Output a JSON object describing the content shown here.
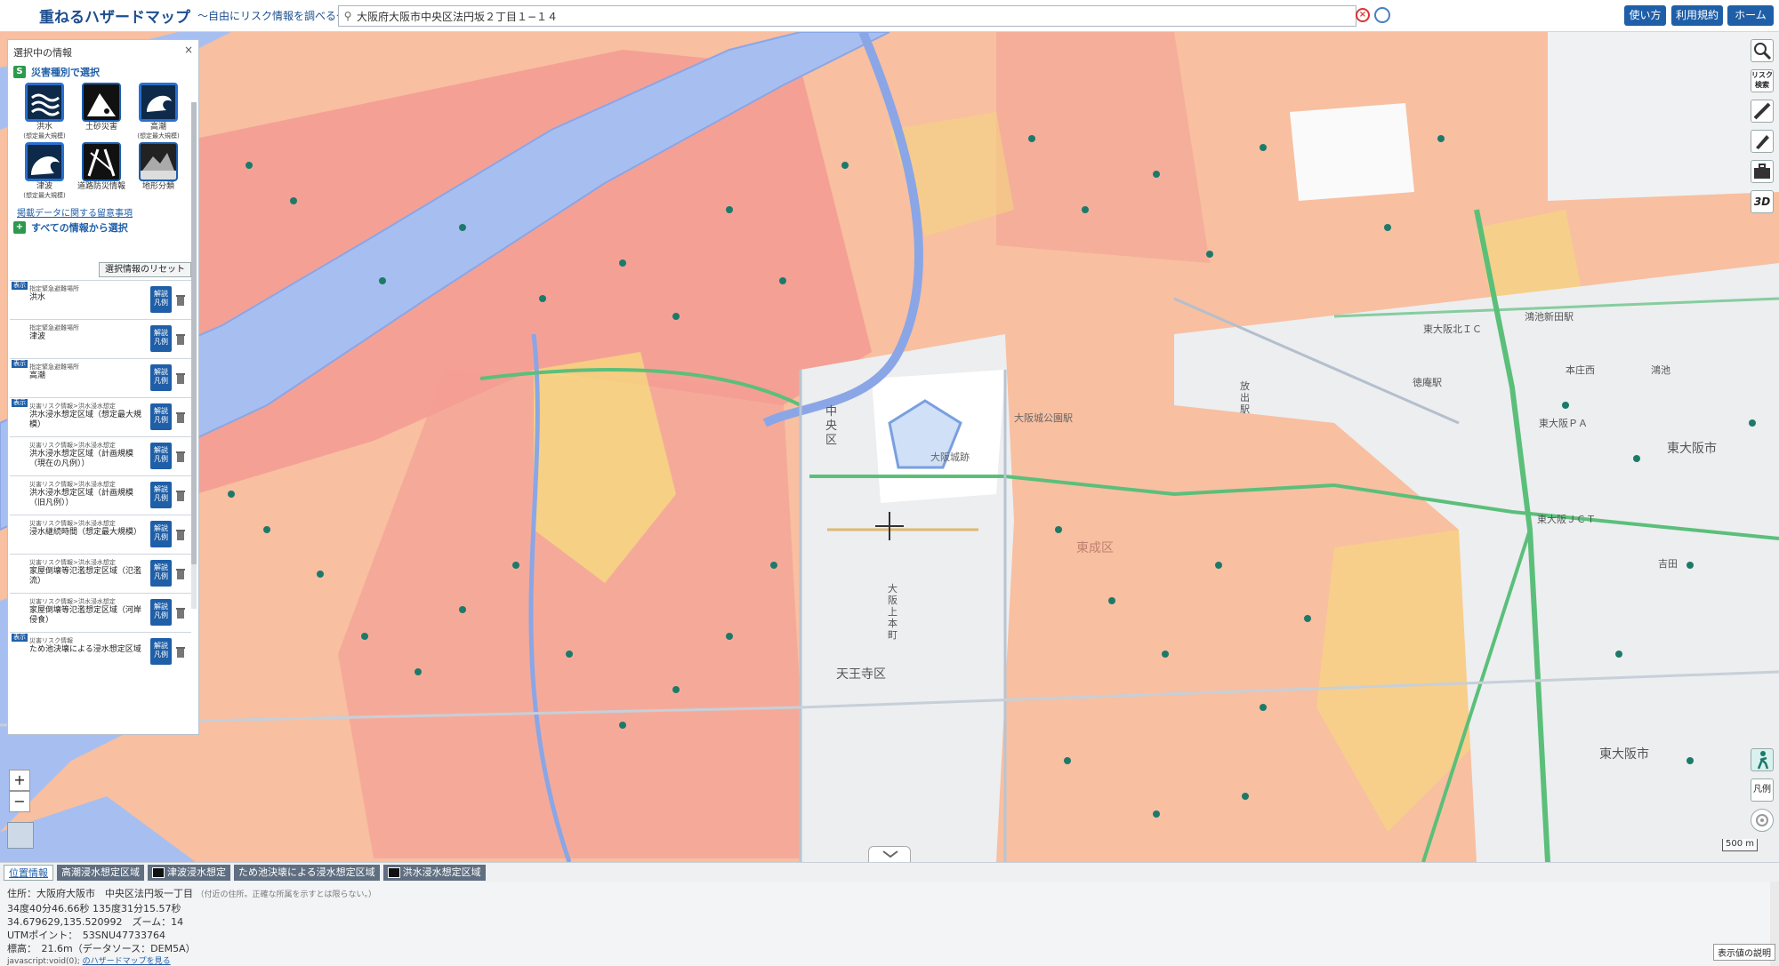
{
  "header": {
    "logo": "重ねるハザードマップ",
    "subtitle": "〜自由にリスク情報を調べる〜",
    "search_value": "大阪府大阪市中央区法円坂２丁目１−１４",
    "clear_label": "×",
    "buttons": {
      "usage": "使い方",
      "terms": "利用規約",
      "home": "ホーム"
    }
  },
  "panel": {
    "title": "選択中の情報",
    "close": "×",
    "by_type_heading": "災害種別で選択",
    "hazards": [
      {
        "label": "洪水",
        "sub": "(想定最大規模)"
      },
      {
        "label": "土砂災害",
        "sub": ""
      },
      {
        "label": "高潮",
        "sub": "(想定最大規模)"
      },
      {
        "label": "津波",
        "sub": "(想定最大規模)"
      },
      {
        "label": "道路防災情報",
        "sub": ""
      },
      {
        "label": "地形分類",
        "sub": ""
      }
    ],
    "notes_link": "掲載データに関する留意事項",
    "all_info_heading": "すべての情報から選択",
    "reset_label": "選択情報のリセット",
    "layers": [
      {
        "badge": "表示",
        "category": "指定緊急避難場所",
        "name": "洪水"
      },
      {
        "badge": "",
        "category": "指定緊急避難場所",
        "name": "津波"
      },
      {
        "badge": "表示",
        "category": "指定緊急避難場所",
        "name": "高潮"
      },
      {
        "badge": "表示",
        "category": "災害リスク情報>洪水浸水想定",
        "name": "洪水浸水想定区域（想定最大規模）"
      },
      {
        "badge": "",
        "category": "災害リスク情報>洪水浸水想定",
        "name": "洪水浸水想定区域（計画規模（現在の凡例））"
      },
      {
        "badge": "",
        "category": "災害リスク情報>洪水浸水想定",
        "name": "洪水浸水想定区域（計画規模（旧凡例））"
      },
      {
        "badge": "",
        "category": "災害リスク情報>洪水浸水想定",
        "name": "浸水継続時間（想定最大規模）"
      },
      {
        "badge": "",
        "category": "災害リスク情報>洪水浸水想定",
        "name": "家屋倒壊等氾濫想定区域（氾濫流）"
      },
      {
        "badge": "",
        "category": "災害リスク情報>洪水浸水想定",
        "name": "家屋倒壊等氾濫想定区域（河岸侵食）"
      },
      {
        "badge": "表示",
        "category": "災害リスク情報",
        "name": "ため池決壊による浸水想定区域"
      }
    ],
    "kaisetsu_label": "解説",
    "hanrei_label": "凡例"
  },
  "map": {
    "labels": [
      {
        "id": "chuo",
        "text": "中央区"
      },
      {
        "id": "osakajo",
        "text": "大阪城跡"
      },
      {
        "id": "osakakoen",
        "text": "大阪城公園駅"
      },
      {
        "id": "tennoji",
        "text": "天王寺区"
      },
      {
        "id": "higashinari",
        "text": "東成区"
      },
      {
        "id": "higashiosaka",
        "text": "東大阪市"
      },
      {
        "id": "higashiosaka2",
        "text": "東大阪市"
      },
      {
        "id": "kosaka",
        "text": "放出駅"
      },
      {
        "id": "tokuan",
        "text": "徳庵駅"
      },
      {
        "id": "kosakasta",
        "text": "鴻池新田駅"
      },
      {
        "id": "higashiosakapa",
        "text": "東大阪ＰＡ"
      },
      {
        "id": "higashiosakajct",
        "text": "東大阪ＪＣＴ"
      },
      {
        "id": "higashiosakaic",
        "text": "東大阪北ＩＣ"
      },
      {
        "id": "uemachi",
        "text": "大阪上本町"
      },
      {
        "id": "yoshida",
        "text": "吉田"
      },
      {
        "id": "hondori",
        "text": "本庄西"
      },
      {
        "id": "kawamata",
        "text": "鴻池"
      }
    ],
    "zoom_in": "+",
    "zoom_out": "−",
    "scale": "500 m"
  },
  "toolbar_right": [
    {
      "name": "search-tool-icon",
      "label": ""
    },
    {
      "name": "risk-search-icon",
      "label": "リスク検索"
    },
    {
      "name": "measure-icon",
      "label": ""
    },
    {
      "name": "draw-icon",
      "label": ""
    },
    {
      "name": "toolbox-icon",
      "label": ""
    },
    {
      "name": "3d-icon",
      "label": "3D"
    }
  ],
  "right_bottom": {
    "shelter": "",
    "legend": "凡例"
  },
  "tabs": [
    {
      "label": "位置情報",
      "active": true
    },
    {
      "label": "高潮浸水想定区域",
      "active": false
    },
    {
      "label": "津波浸水想定",
      "active": false
    },
    {
      "label": "ため池決壊による浸水想定区域",
      "active": false
    },
    {
      "label": "洪水浸水想定区域",
      "active": false
    }
  ],
  "info": {
    "address": "住所：大阪府大阪市　中央区法円坂一丁目",
    "address_note": "（付近の住所。正確な所属を示すとは限らない。）",
    "dms": "34度40分46.66秒 135度31分15.57秒",
    "decimal": "34.679629,135.520992　ズーム：14",
    "utm": "UTMポイント：　53SNU47733764",
    "elevation": "標高：　21.6m（データソース：DEM5A）",
    "status": "javascript:void(0);",
    "status_link": "のハザードマップを見る"
  },
  "legend_button": "表示値の説明",
  "colors": {
    "brand": "#1f5fa8",
    "flood_pink": "#f7a7a0",
    "flood_orange": "#f9c0a0",
    "river": "#9fb8ee",
    "park_green": "#5bbf7a"
  }
}
